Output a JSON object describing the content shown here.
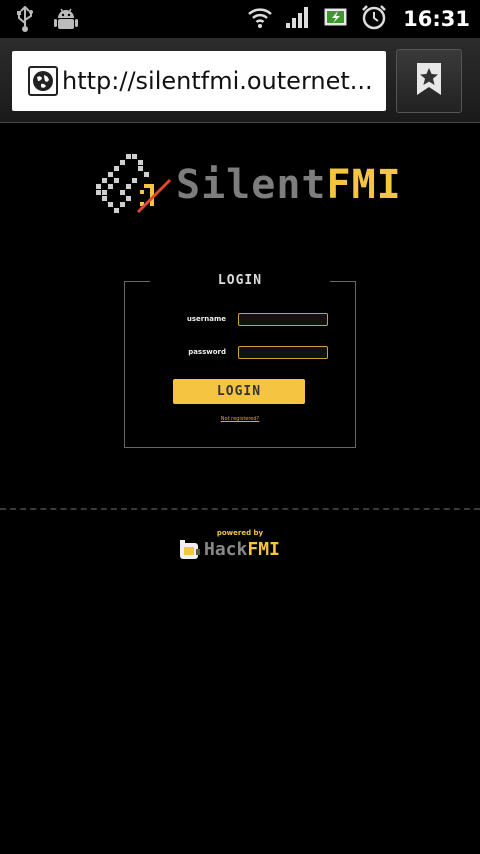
{
  "statusbar": {
    "time": "16:31",
    "icons": [
      "usb-icon",
      "android-debug-icon",
      "wifi-icon",
      "signal-icon",
      "battery-charging-icon",
      "alarm-icon"
    ]
  },
  "browser": {
    "url": "http://silentfmi.outernet...",
    "bookmark_icon": "star-bookmark-icon"
  },
  "logo": {
    "part1": "Silent",
    "part2": "FMI"
  },
  "login": {
    "legend": "LOGIN",
    "username_label": "username",
    "username_value": "",
    "password_label": "password",
    "password_value": "",
    "submit_label": "LOGIN",
    "register_link": "Not registered?"
  },
  "footer": {
    "powered_by": "powered by",
    "brand_part1": "Hack",
    "brand_part2": "FMI"
  },
  "colors": {
    "accent": "#f5c542",
    "background": "#000000",
    "logo_grey": "#7d7d7d"
  }
}
